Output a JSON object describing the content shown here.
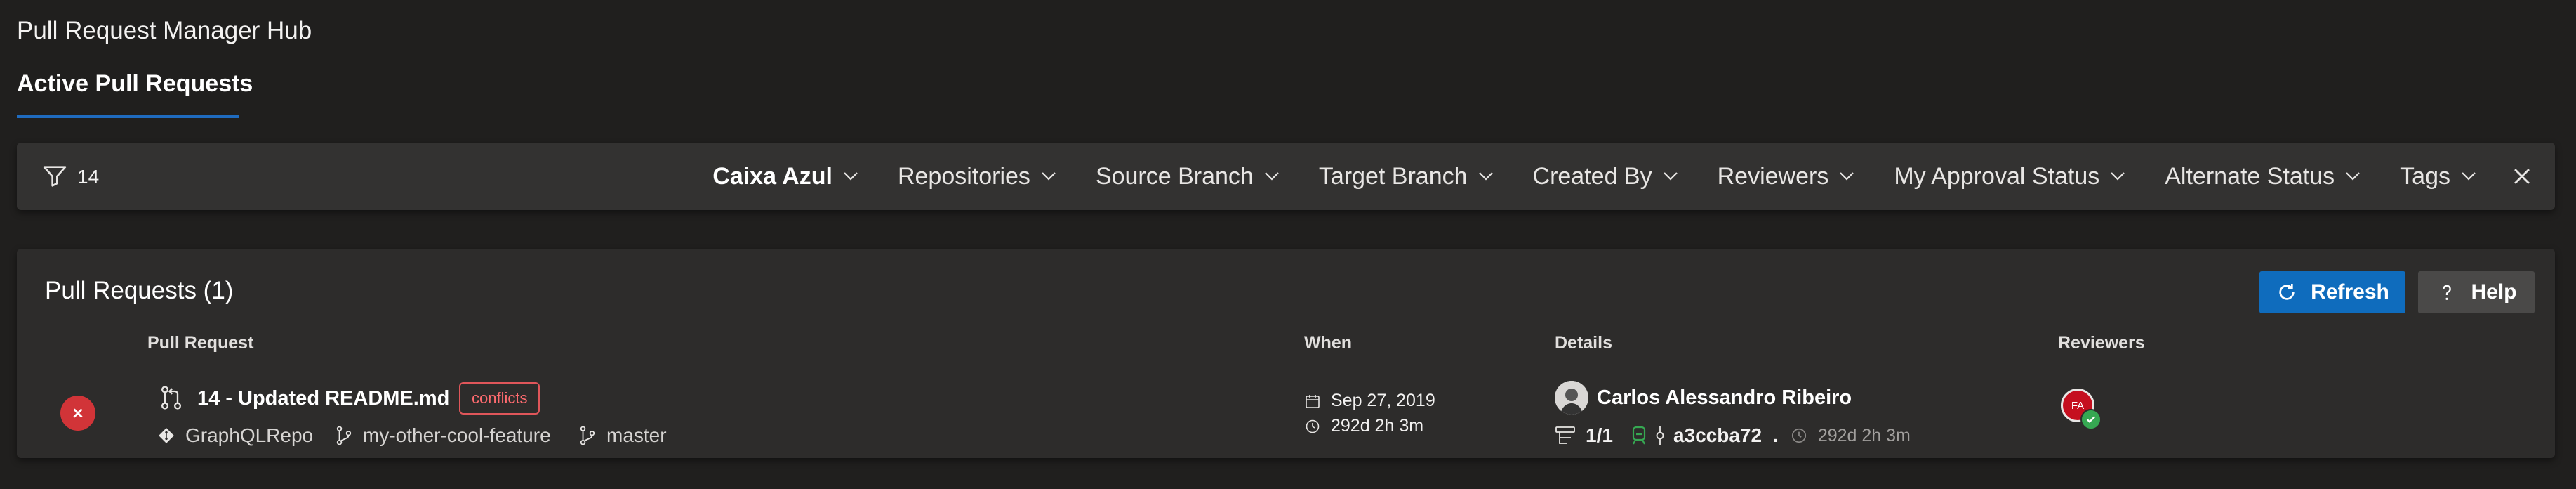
{
  "app": {
    "title": "Pull Request Manager Hub"
  },
  "tabs": [
    {
      "label": "Active Pull Requests",
      "active": true
    }
  ],
  "filter_bar": {
    "count": "14",
    "filters": [
      {
        "label": "Caixa Azul",
        "bold": true
      },
      {
        "label": "Repositories"
      },
      {
        "label": "Source Branch"
      },
      {
        "label": "Target Branch"
      },
      {
        "label": "Created By"
      },
      {
        "label": "Reviewers"
      },
      {
        "label": "My Approval Status"
      },
      {
        "label": "Alternate Status"
      },
      {
        "label": "Tags"
      }
    ],
    "close_icon": "close-icon"
  },
  "panel": {
    "title": "Pull Requests (1)",
    "refresh_label": "Refresh",
    "help_label": "Help",
    "columns": {
      "pull_request": "Pull Request",
      "when": "When",
      "details": "Details",
      "reviewers": "Reviewers"
    }
  },
  "pull_requests": [
    {
      "status": "failed",
      "title": "14 - Updated README.md",
      "badge": "conflicts",
      "repo": "GraphQLRepo",
      "source_branch": "my-other-cool-feature",
      "target_branch": "master",
      "date": "Sep 27, 2019",
      "age": "292d 2h 3m",
      "author": "Carlos Alessandro Ribeiro",
      "iterations": "1/1",
      "commit": "a3ccba72",
      "commit_suffix": ".",
      "commit_age": "292d 2h 3m",
      "reviewer_initials": "FA",
      "reviewer_vote": "approved"
    }
  ],
  "colors": {
    "background": "#201f1e",
    "accent": "#0f6cbd",
    "error": "#d13438",
    "conflict": "#e0565a",
    "success": "#36a852"
  }
}
